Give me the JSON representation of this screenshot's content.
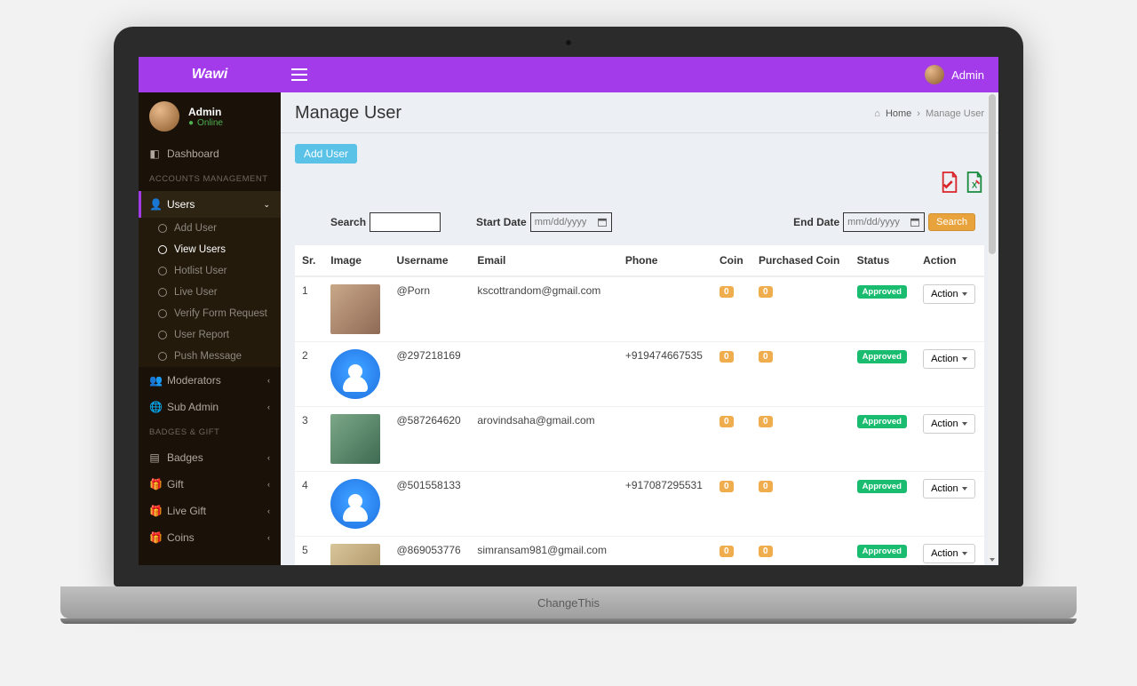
{
  "brand": "Wawi",
  "topbar_user": "Admin",
  "laptop_base_label": "ChangeThis",
  "sidebar": {
    "user_name": "Admin",
    "user_status": "Online",
    "dashboard": "Dashboard",
    "section_accounts": "ACCOUNTS MANAGEMENT",
    "users": "Users",
    "sub": {
      "add_user": "Add User",
      "view_users": "View Users",
      "hotlist_user": "Hotlist User",
      "live_user": "Live User",
      "verify_form": "Verify Form Request",
      "user_report": "User Report",
      "push_message": "Push Message"
    },
    "moderators": "Moderators",
    "sub_admin": "Sub Admin",
    "section_badges": "BADGES & GIFT",
    "badges": "Badges",
    "gift": "Gift",
    "live_gift": "Live Gift",
    "coins": "Coins"
  },
  "page": {
    "title": "Manage User",
    "breadcrumb_home": "Home",
    "breadcrumb_current": "Manage User",
    "add_user_btn": "Add User",
    "search_label": "Search",
    "start_date_label": "Start Date",
    "end_date_label": "End Date",
    "date_placeholder": "mm/dd/yyyy",
    "search_btn": "Search"
  },
  "table": {
    "headers": {
      "sr": "Sr.",
      "image": "Image",
      "username": "Username",
      "email": "Email",
      "phone": "Phone",
      "coin": "Coin",
      "purchased": "Purchased Coin",
      "status": "Status",
      "action": "Action"
    },
    "action_label": "Action",
    "status_approved": "Approved",
    "rows": [
      {
        "sr": "1",
        "username": "@Porn",
        "email": "kscottrandom@gmail.com",
        "phone": "",
        "coin": "0",
        "purchased": "0",
        "img": "photo1"
      },
      {
        "sr": "2",
        "username": "@297218169",
        "email": "",
        "phone": "+919474667535",
        "coin": "0",
        "purchased": "0",
        "img": "circle"
      },
      {
        "sr": "3",
        "username": "@587264620",
        "email": "arovindsaha@gmail.com",
        "phone": "",
        "coin": "0",
        "purchased": "0",
        "img": "photo2"
      },
      {
        "sr": "4",
        "username": "@501558133",
        "email": "",
        "phone": "+917087295531",
        "coin": "0",
        "purchased": "0",
        "img": "circle"
      },
      {
        "sr": "5",
        "username": "@869053776",
        "email": "simransam981@gmail.com",
        "phone": "",
        "coin": "0",
        "purchased": "0",
        "img": "photo3"
      }
    ]
  }
}
